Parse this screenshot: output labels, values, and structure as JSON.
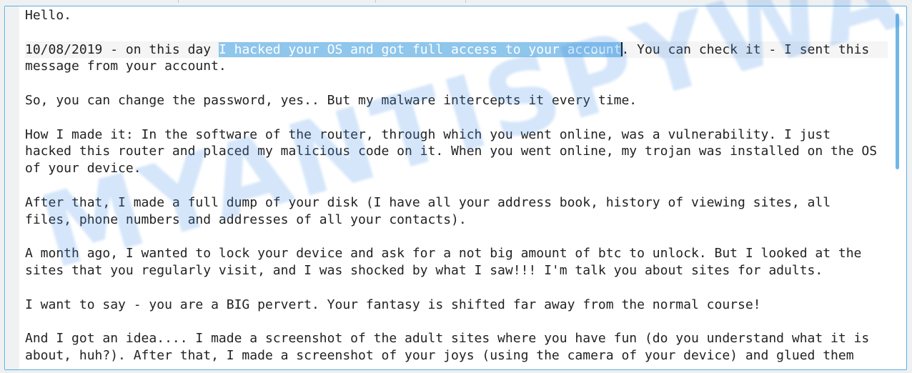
{
  "editor": {
    "lines": [
      {
        "text": "Hello."
      },
      {
        "text": ""
      },
      {
        "before": "10/08/2019 - on this day ",
        "selected": "I hacked your OS and got full access to your account",
        "after": ". You can check it - I sent this",
        "current": true
      },
      {
        "text": "message from your account."
      },
      {
        "text": ""
      },
      {
        "text": "So, you can change the password, yes.. But my malware intercepts it every time."
      },
      {
        "text": ""
      },
      {
        "text": "How I made it: In the software of the router, through which you went online, was a vulnerability. I just"
      },
      {
        "text": "hacked this router and placed my malicious code on it. When you went online, my trojan was installed on the OS"
      },
      {
        "text": "of your device."
      },
      {
        "text": ""
      },
      {
        "text": "After that, I made a full dump of your disk (I have all your address book, history of viewing sites, all"
      },
      {
        "text": "files, phone numbers and addresses of all your contacts)."
      },
      {
        "text": ""
      },
      {
        "text": "A month ago, I wanted to lock your device and ask for a not big amount of btc to unlock. But I looked at the"
      },
      {
        "text": "sites that you regularly visit, and I was shocked by what I saw!!! I'm talk you about sites for adults."
      },
      {
        "text": ""
      },
      {
        "text": "I want to say - you are a BIG pervert. Your fantasy is shifted far away from the normal course!"
      },
      {
        "text": ""
      },
      {
        "text": "And I got an idea.... I made a screenshot of the adult sites where you have fun (do you understand what it is"
      },
      {
        "text": "about, huh?). After that, I made a screenshot of your joys (using the camera of your device) and glued them"
      }
    ]
  },
  "watermark": "MYANTISPYWARE.COM",
  "colors": {
    "accent": "#5aaee0",
    "selection": "#8ec6ec",
    "scrollbar": "#6fb8e6"
  }
}
